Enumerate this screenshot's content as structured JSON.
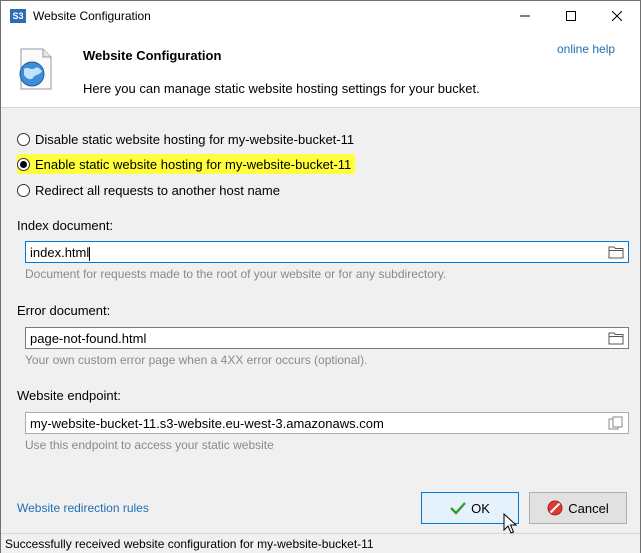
{
  "window": {
    "title": "Website Configuration",
    "app_icon_text": "S3"
  },
  "header": {
    "title": "Website Configuration",
    "description": "Here you can manage static website hosting settings for your bucket.",
    "help_link": "online help"
  },
  "hosting_options": {
    "disable_label": "Disable static website hosting for my-website-bucket-11",
    "enable_label": "Enable static website hosting for my-website-bucket-11",
    "redirect_label": "Redirect all requests to another host name",
    "selected": "enable"
  },
  "index_document": {
    "label": "Index document:",
    "value": "index.html",
    "hint": "Document for requests made to the root of your website or for any subdirectory."
  },
  "error_document": {
    "label": "Error document:",
    "value": "page-not-found.html",
    "hint": "Your own custom error page when a 4XX error occurs (optional)."
  },
  "endpoint": {
    "label": "Website endpoint:",
    "value": "my-website-bucket-11.s3-website.eu-west-3.amazonaws.com",
    "hint": "Use this endpoint to access your static website"
  },
  "footer": {
    "redirection_link": "Website redirection rules",
    "ok_label": "OK",
    "cancel_label": "Cancel"
  },
  "status_bar": {
    "text": "Successfully received website configuration for my-website-bucket-11"
  },
  "colors": {
    "highlight": "#ffff3c",
    "link": "#1e6fb5",
    "focus": "#0078d7"
  }
}
